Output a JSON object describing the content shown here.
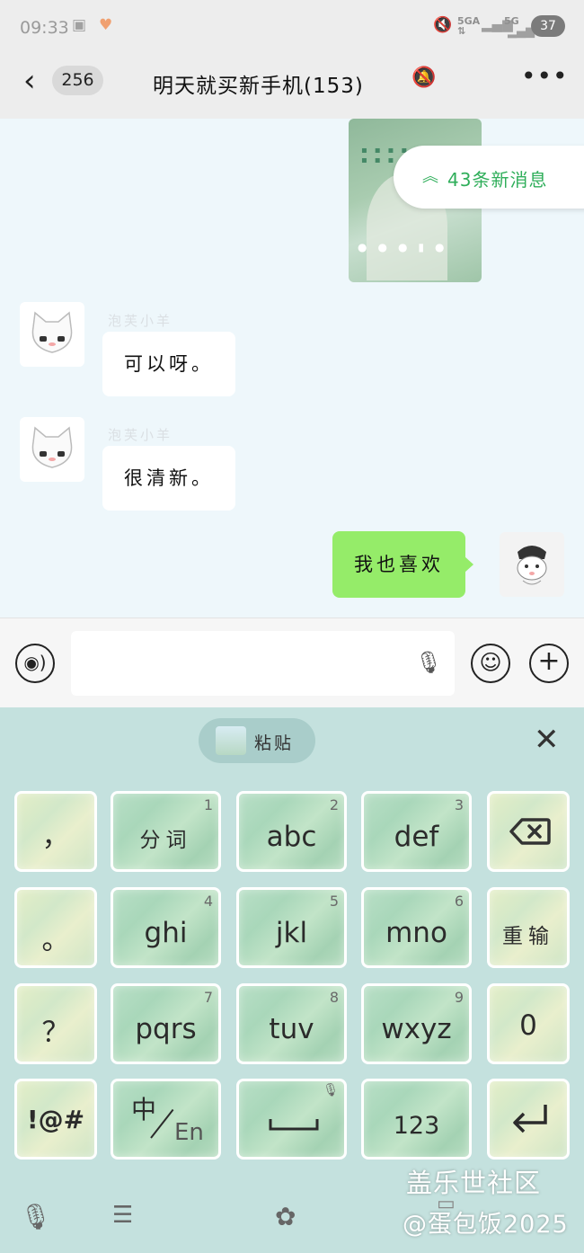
{
  "status_bar": {
    "time": "09:33",
    "net1": "5GA",
    "net2": "5G",
    "battery": "37"
  },
  "header": {
    "unread_count": "256",
    "title": "明天就买新手机(153)"
  },
  "new_messages": {
    "label": "43条新消息"
  },
  "messages": [
    {
      "sender": "泡芙小羊",
      "text": "可以呀。",
      "direction": "in"
    },
    {
      "sender": "泡芙小羊",
      "text": "很清新。",
      "direction": "in"
    },
    {
      "text": "我也喜欢",
      "direction": "out"
    }
  ],
  "keyboard": {
    "paste_label": "粘贴",
    "keys": {
      "comma": "，",
      "period": "。",
      "question": "？",
      "symbols": "!@#",
      "split_words": "分词",
      "abc": "abc",
      "def": "def",
      "ghi": "ghi",
      "jkl": "jkl",
      "mno": "mno",
      "pqrs": "pqrs",
      "tuv": "tuv",
      "wxyz": "wxyz",
      "reenter": "重输",
      "zero": "0",
      "lang_cn": "中",
      "lang_en": "En",
      "numbers": "123"
    },
    "digits": {
      "one": "1",
      "two": "2",
      "three": "3",
      "four": "4",
      "five": "5",
      "six": "6",
      "seven": "7",
      "eight": "8",
      "nine": "9"
    }
  },
  "watermark": {
    "line1": "盖乐世社区",
    "line2": "@蛋包饭2025"
  },
  "colors": {
    "accent_green": "#2fae5a",
    "out_bubble": "#95ec69",
    "keyboard_bg": "#c4e1de"
  }
}
